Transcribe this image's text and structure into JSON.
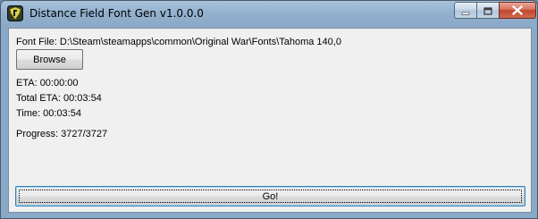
{
  "window": {
    "title": "Distance Field Font Gen v1.0.0.0",
    "icon": "app-icon",
    "controls": {
      "minimize": "minimize-icon",
      "maximize": "maximize-icon",
      "close": "close-icon"
    }
  },
  "form": {
    "font_file_text": "Font File: D:\\Steam\\steamapps\\common\\Original War\\Fonts\\Tahoma 140,0",
    "browse_label": "Browse",
    "eta_text": "ETA: 00:00:00",
    "total_eta_text": "Total ETA: 00:03:54",
    "time_text": "Time: 00:03:54",
    "progress_text": "Progress: 3727/3727",
    "go_label": "Go!"
  },
  "colors": {
    "titlebar": "#8aa9c8",
    "client_bg": "#f0f0f0",
    "close_button": "#c2452b"
  }
}
